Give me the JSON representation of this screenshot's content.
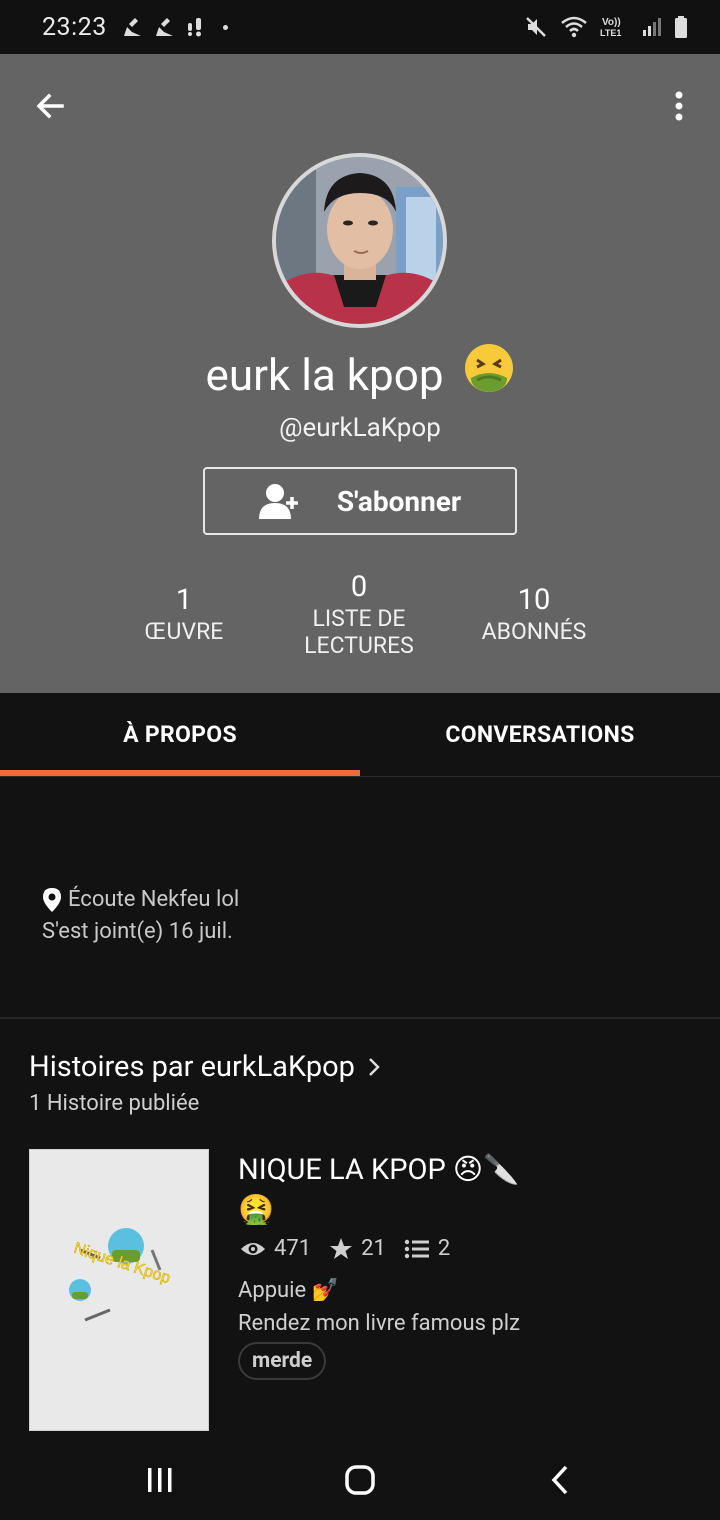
{
  "status_bar": {
    "time": "23:23",
    "left_icons": [
      "broom-icon",
      "broom-icon",
      "notification-icon"
    ],
    "right_icons": [
      "mute-icon",
      "wifi-icon",
      "volte-icon",
      "signal-icon",
      "battery-icon"
    ],
    "volte_label": "Vo))\nLTE1"
  },
  "header": {
    "display_name": "eurk la kpop",
    "display_name_emoji": "🤮",
    "username": "@eurkLaKpop",
    "follow_label": "S'abonner",
    "background_color": "#646464"
  },
  "stats": [
    {
      "number": "1",
      "label_line1": "ŒUVRE",
      "label_line2": ""
    },
    {
      "number": "0",
      "label_line1": "LISTE DE",
      "label_line2": "LECTURES"
    },
    {
      "number": "10",
      "label_line1": "ABONNÉS",
      "label_line2": ""
    }
  ],
  "tabs": [
    {
      "label": "À PROPOS",
      "active": true
    },
    {
      "label": "CONVERSATIONS",
      "active": false
    }
  ],
  "about": {
    "location": "Écoute Nekfeu lol",
    "joined": "S'est joint(e) 16 juil."
  },
  "stories": {
    "title": "Histoires par eurkLaKpop",
    "subtitle": "1 Histoire publiée",
    "items": [
      {
        "title": "NIQUE LA KPOP 😠🔪",
        "title_line2": "🤮",
        "reads": "471",
        "votes": "21",
        "parts": "2",
        "desc_line1": "Appuie 💅",
        "desc_line2": "Rendez mon livre famous plz",
        "tag": "merde",
        "cover_text": "Nique la Kpop"
      }
    ]
  },
  "colors": {
    "accent": "#f06b3c",
    "dark_bg": "#121212"
  }
}
